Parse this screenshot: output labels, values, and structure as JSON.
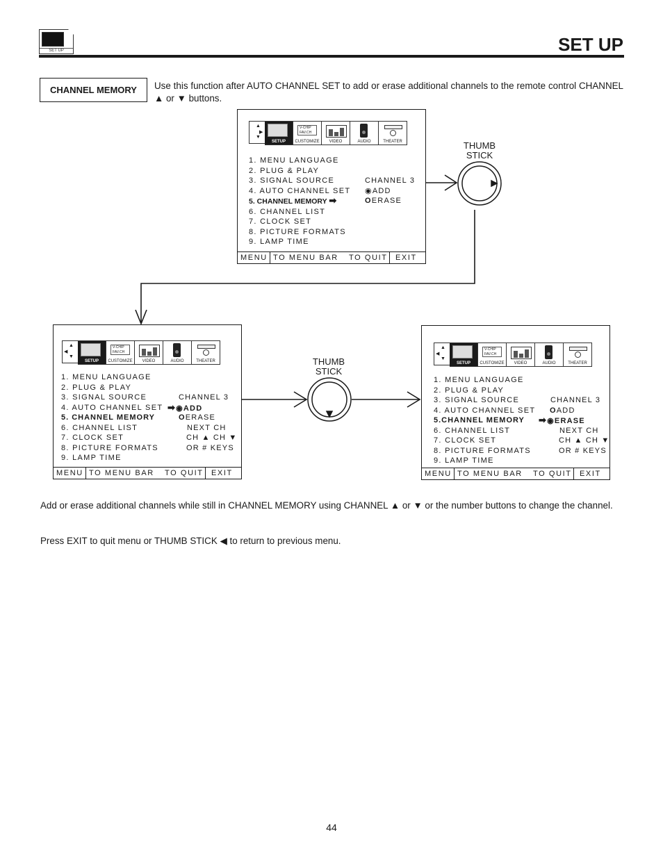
{
  "header": {
    "icon_label": "SET UP",
    "title": "SET UP"
  },
  "intro": {
    "section_label": "CHANNEL MEMORY",
    "text": "Use this function after AUTO CHANNEL SET to add or erase additional channels to the remote control CHANNEL ▲ or ▼ buttons."
  },
  "tabs": [
    "SETUP",
    "CUSTOMIZE",
    "VIDEO",
    "AUDIO",
    "THEATER"
  ],
  "customize_icon_text": [
    "V-CHIP",
    "FAV.CH"
  ],
  "menu_items": [
    "1. MENU LANGUAGE",
    "2. PLUG & PLAY",
    "3. SIGNAL SOURCE",
    "4. AUTO CHANNEL SET",
    "5. CHANNEL MEMORY",
    "6. CHANNEL LIST",
    "7. CLOCK SET",
    "8. PICTURE FORMATS",
    "9. LAMP TIME"
  ],
  "menu_item_5_alt": "5.CHANNEL MEMORY",
  "footer": {
    "menu": "MENU",
    "to_menu_bar": "TO MENU BAR",
    "to_quit": "TO QUIT",
    "exit": "EXIT"
  },
  "options": {
    "channel": "CHANNEL 3",
    "add": "ADD",
    "erase": "ERASE",
    "next_ch": "NEXT CH",
    "ch_keys": "CH ▲  CH ▼",
    "or_keys": "OR # KEYS"
  },
  "panels": [
    {
      "name": "initial",
      "highlighted_item": "5. CHANNEL MEMORY",
      "selected_option": "ADD"
    },
    {
      "name": "add-selected",
      "highlighted_item": "5. CHANNEL MEMORY",
      "selected_option": "ADD",
      "pointer_on": "ADD"
    },
    {
      "name": "erase-selected",
      "highlighted_item": "5.CHANNEL MEMORY",
      "selected_option": "ERASE",
      "pointer_on": "ERASE"
    }
  ],
  "thumb_stick_label": [
    "THUMB",
    "STICK"
  ],
  "body": {
    "para1": "Add or erase additional channels while still in CHANNEL MEMORY using CHANNEL ▲ or ▼ or the number buttons to change the channel.",
    "para2": "Press EXIT to quit menu or THUMB STICK ◀ to return to previous menu."
  },
  "page_number": "44"
}
